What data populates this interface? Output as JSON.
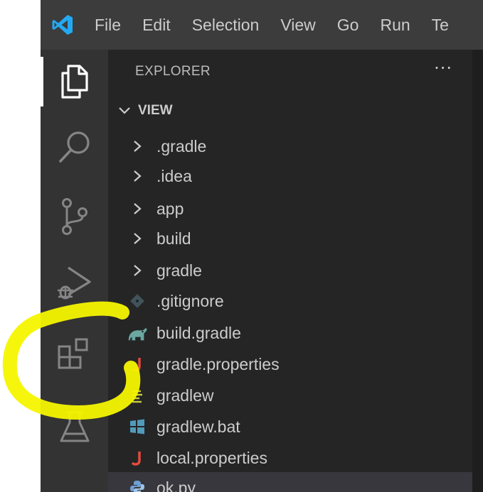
{
  "menu": [
    "File",
    "Edit",
    "Selection",
    "View",
    "Go",
    "Run",
    "Te"
  ],
  "activity_bar": [
    {
      "name": "explorer",
      "icon": "files-icon",
      "active": true
    },
    {
      "name": "search",
      "icon": "search-icon",
      "active": false
    },
    {
      "name": "source-control",
      "icon": "source-control-icon",
      "active": false
    },
    {
      "name": "run-and-debug",
      "icon": "run-debug-icon",
      "active": false
    },
    {
      "name": "extensions",
      "icon": "extensions-icon",
      "active": false
    },
    {
      "name": "testing",
      "icon": "beaker-icon",
      "active": false
    }
  ],
  "explorer": {
    "title": "EXPLORER",
    "more": "···",
    "folder": "VIEW",
    "items": [
      {
        "label": ".gradle",
        "type": "folder",
        "icon": "chevron-right-icon"
      },
      {
        "label": ".idea",
        "type": "folder",
        "icon": "chevron-right-icon"
      },
      {
        "label": "app",
        "type": "folder",
        "icon": "chevron-right-icon"
      },
      {
        "label": "build",
        "type": "folder",
        "icon": "chevron-right-icon"
      },
      {
        "label": "gradle",
        "type": "folder",
        "icon": "chevron-right-icon"
      },
      {
        "label": ".gitignore",
        "type": "file",
        "icon": "git-file-icon"
      },
      {
        "label": "build.gradle",
        "type": "file",
        "icon": "gradle-elephant-icon"
      },
      {
        "label": "gradle.properties",
        "type": "file",
        "icon": "java-j-icon"
      },
      {
        "label": "gradlew",
        "type": "file",
        "icon": "text-lines-icon"
      },
      {
        "label": "gradlew.bat",
        "type": "file",
        "icon": "windows-icon"
      },
      {
        "label": "local.properties",
        "type": "file",
        "icon": "java-j-icon"
      },
      {
        "label": "ok.py",
        "type": "file",
        "icon": "python-icon"
      }
    ]
  },
  "colors": {
    "titlebar": "#3c3c3c",
    "activitybar": "#333333",
    "sidebar": "#252526",
    "highlight": "#f5f500",
    "vscode_blue": "#23a9f2"
  }
}
